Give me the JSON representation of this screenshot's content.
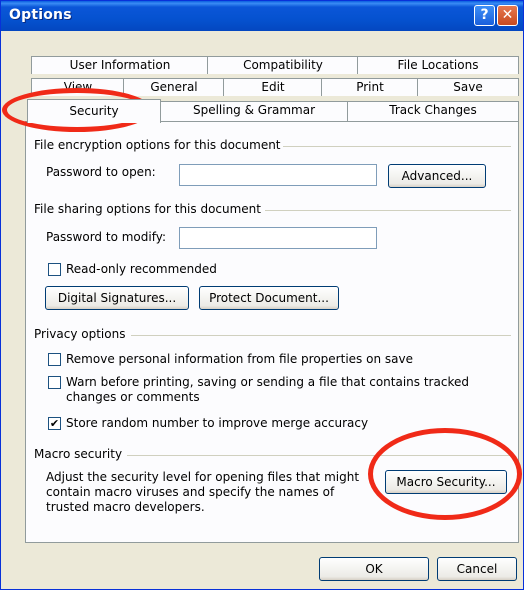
{
  "window": {
    "title": "Options",
    "help_glyph": "?",
    "close_glyph": "✕"
  },
  "tabs": {
    "row1": [
      "User Information",
      "Compatibility",
      "File Locations"
    ],
    "row2": [
      "View",
      "General",
      "Edit",
      "Print",
      "Save"
    ],
    "row3": [
      "Security",
      "Spelling & Grammar",
      "Track Changes"
    ],
    "active": "Security"
  },
  "encryption": {
    "group_label": "File encryption options for this document",
    "password_open_label": "Password to open:",
    "password_open_value": "",
    "advanced_button": "Advanced..."
  },
  "sharing": {
    "group_label": "File sharing options for this document",
    "password_modify_label": "Password to modify:",
    "password_modify_value": "",
    "readonly_label": "Read-only recommended",
    "readonly_checked": "",
    "digital_signatures_button": "Digital Signatures...",
    "protect_document_button": "Protect Document..."
  },
  "privacy": {
    "group_label": "Privacy options",
    "remove_personal_label": "Remove personal information from file properties on save",
    "warn_line1": "Warn before printing, saving or sending a file that contains tracked",
    "warn_line2": "changes or comments",
    "store_random_label": "Store random number to improve merge accuracy",
    "store_random_checked": "✔"
  },
  "macro": {
    "group_label": "Macro security",
    "desc_line1": "Adjust the security level for opening files that might",
    "desc_line2": "contain macro viruses and specify the names of",
    "desc_line3": "trusted macro developers.",
    "macro_security_button": "Macro Security..."
  },
  "footer": {
    "ok_button": "OK",
    "cancel_button": "Cancel"
  },
  "colors": {
    "annotation": "#f02a18",
    "titlebar": "#0552d0"
  }
}
